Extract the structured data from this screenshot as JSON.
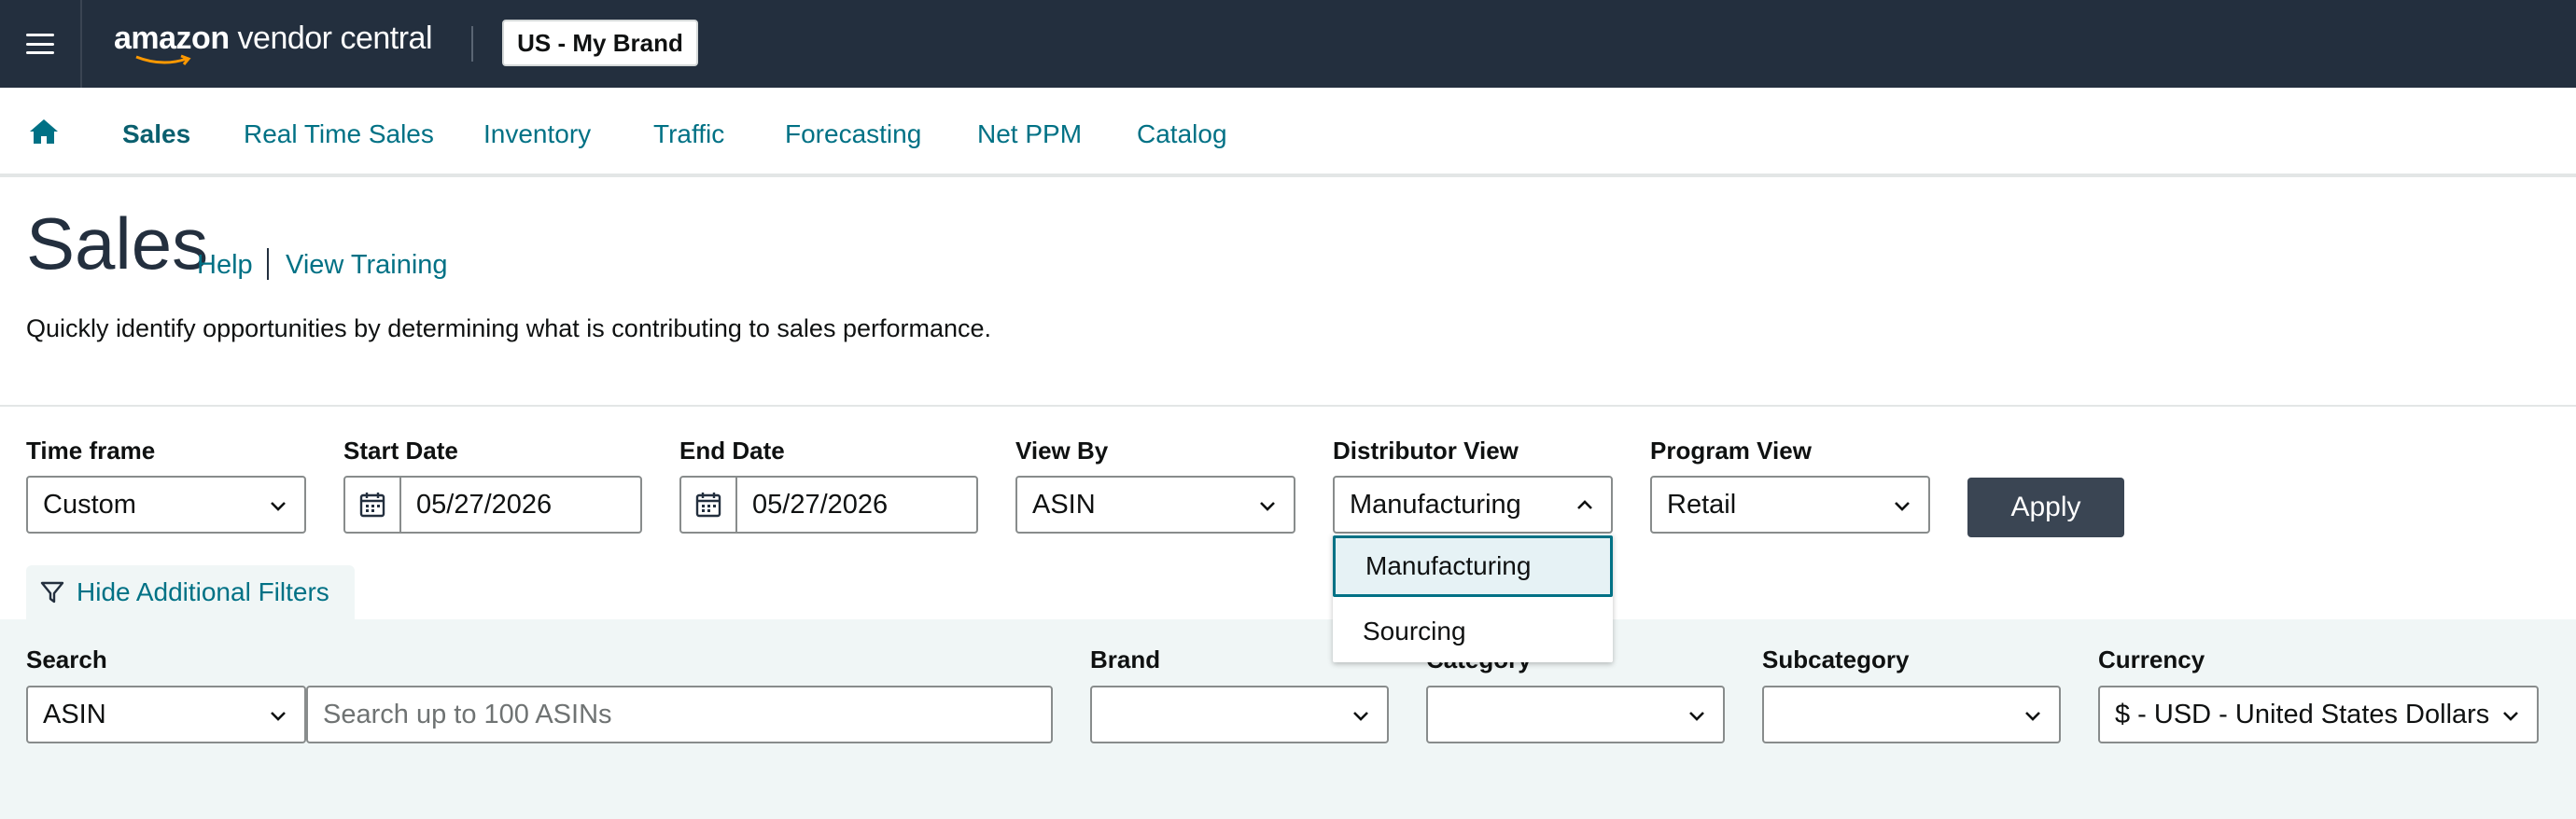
{
  "app": {
    "logo_text_bold": "amazon",
    "logo_text_rest": " vendor central",
    "account_selector": "US - My Brand"
  },
  "nav": {
    "items": [
      {
        "label": "Sales"
      },
      {
        "label": "Real Time Sales"
      },
      {
        "label": "Inventory"
      },
      {
        "label": "Traffic"
      },
      {
        "label": "Forecasting"
      },
      {
        "label": "Net PPM"
      },
      {
        "label": "Catalog"
      }
    ]
  },
  "header": {
    "title": "Sales",
    "help": "Help",
    "training": "View Training",
    "description": "Quickly identify opportunities by determining what is contributing to sales performance."
  },
  "filters": {
    "time_frame": {
      "label": "Time frame",
      "value": "Custom"
    },
    "start_date": {
      "label": "Start Date",
      "value": "05/27/2026"
    },
    "end_date": {
      "label": "End Date",
      "value": "05/27/2026"
    },
    "view_by": {
      "label": "View By",
      "value": "ASIN"
    },
    "distributor_view": {
      "label": "Distributor View",
      "value": "Manufacturing",
      "options": [
        "Manufacturing",
        "Sourcing"
      ]
    },
    "program_view": {
      "label": "Program View",
      "value": "Retail"
    },
    "apply": "Apply",
    "hide_additional": "Hide Additional Filters"
  },
  "additional_filters": {
    "search": {
      "label": "Search",
      "type_value": "ASIN",
      "placeholder": "Search up to 100 ASINs"
    },
    "brand": {
      "label": "Brand",
      "value": ""
    },
    "category": {
      "label": "Category",
      "value": ""
    },
    "subcategory": {
      "label": "Subcategory",
      "value": ""
    },
    "currency": {
      "label": "Currency",
      "value": "$ - USD - United States Dollars"
    }
  },
  "colors": {
    "topbar": "#232f3e",
    "link": "#007185",
    "panel": "#f0f6f6",
    "apply_button": "#3a4553"
  }
}
